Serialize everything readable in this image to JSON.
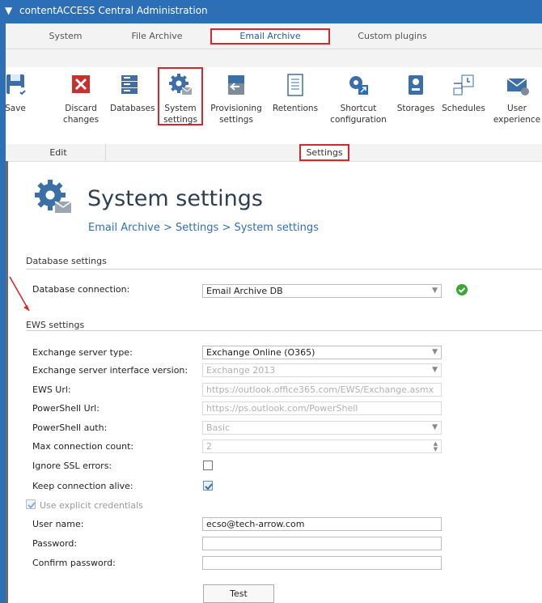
{
  "app": {
    "title": "contentACCESS Central Administration"
  },
  "tabs": [
    "System",
    "File Archive",
    "Email Archive",
    "Custom plugins"
  ],
  "ribbon": {
    "buttons": [
      {
        "label": "Save",
        "icon": "save-icon"
      },
      {
        "label": "Discard changes",
        "icon": "discard-icon"
      },
      {
        "label": "Databases",
        "icon": "database-icon"
      },
      {
        "label": "System settings",
        "icon": "gear-icon"
      },
      {
        "label": "Provisioning settings",
        "icon": "provisioning-icon"
      },
      {
        "label": "Retentions",
        "icon": "document-icon"
      },
      {
        "label": "Shortcut configuration",
        "icon": "shortcut-icon"
      },
      {
        "label": "Storages",
        "icon": "storage-icon"
      },
      {
        "label": "Schedules",
        "icon": "schedule-icon"
      },
      {
        "label": "User experience",
        "icon": "envelope-icon"
      }
    ],
    "groups": [
      "Edit",
      "Settings"
    ]
  },
  "page": {
    "title": "System settings",
    "breadcrumb": "Email Archive > Settings > System settings"
  },
  "database": {
    "header": "Database settings",
    "connection_label": "Database connection:",
    "connection_value": "Email Archive DB"
  },
  "ews": {
    "header": "EWS settings",
    "server_type_label": "Exchange server type:",
    "server_type_value": "Exchange Online (O365)",
    "interface_label": "Exchange server interface version:",
    "interface_value": "Exchange 2013",
    "url_label": "EWS Url:",
    "url_value": "https://outlook.office365.com/EWS/Exchange.asmx",
    "ps_url_label": "PowerShell Url:",
    "ps_url_value": "https://ps.outlook.com/PowerShell",
    "ps_auth_label": "PowerShell auth:",
    "ps_auth_value": "Basic",
    "max_conn_label": "Max connection count:",
    "max_conn_value": "2",
    "ignore_ssl_label": "Ignore SSL errors:",
    "keep_alive_label": "Keep connection alive:",
    "explicit_label": "Use explicit credentials",
    "username_label": "User name:",
    "username_value": "ecso@tech-arrow.com",
    "password_label": "Password:",
    "confirm_label": "Confirm password:",
    "test_button": "Test"
  },
  "colors": {
    "accent": "#2d6fb6",
    "highlight": "#d9262c",
    "ok": "#3aa635"
  }
}
